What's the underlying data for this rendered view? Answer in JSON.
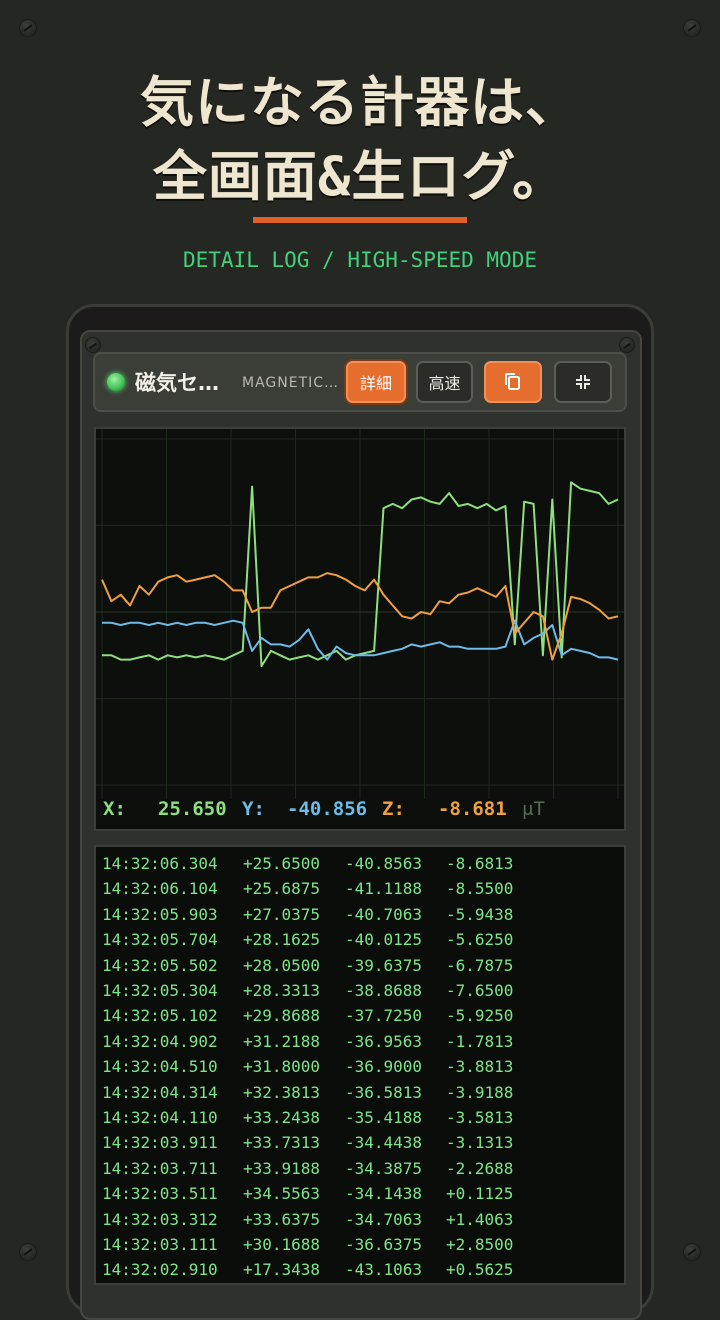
{
  "headline": {
    "line1": "気になる計器は、",
    "line2": "全画面&生ログ。"
  },
  "subtitle": "DETAIL LOG / HIGH-SPEED MODE",
  "sensor": {
    "name": "磁気セ…",
    "name_en": "MAGNETIC…",
    "status": "active"
  },
  "toolbar": {
    "detail_label": "詳細",
    "speed_label": "高速",
    "copy_icon": "copy-icon",
    "collapse_icon": "collapse-icon"
  },
  "colors": {
    "x": "#8ee07e",
    "y": "#6fbbe8",
    "z": "#f0a040",
    "accent": "#e0622a",
    "led": "#4fdc66"
  },
  "readout": {
    "x_label": "X:",
    "x_value": "25.650",
    "y_label": "Y:",
    "y_value": "-40.856",
    "z_label": "Z:",
    "z_value": "-8.681",
    "unit": "μT"
  },
  "chart_data": {
    "type": "line",
    "title": "",
    "xlabel": "",
    "ylabel": "",
    "grid": true,
    "ylim": [
      -80,
      80
    ],
    "series": [
      {
        "values": [
          -20,
          -20,
          -22,
          -22,
          -21,
          -20,
          -22,
          -20,
          -21,
          -20,
          -21,
          -20,
          -21,
          -22,
          -20,
          -18,
          58,
          -25,
          -18,
          -20,
          -22,
          -21,
          -20,
          -22,
          -20,
          -18,
          -22,
          -20,
          -19,
          -18,
          48,
          50,
          48,
          52,
          53,
          51,
          50,
          55,
          49,
          50,
          48,
          50,
          47,
          49,
          -15,
          51,
          50,
          -20,
          52,
          -21,
          60,
          57,
          56,
          55,
          50,
          52
        ]
      },
      {
        "values": [
          -5,
          -5,
          -6,
          -5,
          -5,
          -6,
          -5,
          -6,
          -5,
          -6,
          -5,
          -5,
          -6,
          -5,
          -4,
          -5,
          -18,
          -12,
          -15,
          -15,
          -16,
          -13,
          -8,
          -17,
          -22,
          -16,
          -19,
          -20,
          -20,
          -20,
          -19,
          -18,
          -17,
          -15,
          -16,
          -15,
          -14,
          -16,
          -16,
          -17,
          -17,
          -17,
          -17,
          -16,
          -4,
          -15,
          -12,
          -10,
          -6,
          -20,
          -17,
          -18,
          -19,
          -21,
          -21,
          -22
        ]
      },
      {
        "values": [
          15,
          5,
          8,
          3,
          12,
          8,
          14,
          16,
          17,
          14,
          15,
          16,
          17,
          14,
          10,
          10,
          0,
          2,
          2,
          10,
          12,
          14,
          16,
          16,
          18,
          17,
          15,
          12,
          10,
          15,
          8,
          3,
          -2,
          -3,
          0,
          -1,
          5,
          4,
          8,
          9,
          11,
          9,
          7,
          12,
          -10,
          -5,
          0,
          -2,
          -22,
          -10,
          7,
          6,
          4,
          1,
          -3,
          -2
        ]
      }
    ]
  },
  "log": [
    {
      "time": "14:32:06.304",
      "x": "+25.6500",
      "y": "-40.8563",
      "z": "-8.6813"
    },
    {
      "time": "14:32:06.104",
      "x": "+25.6875",
      "y": "-41.1188",
      "z": "-8.5500"
    },
    {
      "time": "14:32:05.903",
      "x": "+27.0375",
      "y": "-40.7063",
      "z": "-5.9438"
    },
    {
      "time": "14:32:05.704",
      "x": "+28.1625",
      "y": "-40.0125",
      "z": "-5.6250"
    },
    {
      "time": "14:32:05.502",
      "x": "+28.0500",
      "y": "-39.6375",
      "z": "-6.7875"
    },
    {
      "time": "14:32:05.304",
      "x": "+28.3313",
      "y": "-38.8688",
      "z": "-7.6500"
    },
    {
      "time": "14:32:05.102",
      "x": "+29.8688",
      "y": "-37.7250",
      "z": "-5.9250"
    },
    {
      "time": "14:32:04.902",
      "x": "+31.2188",
      "y": "-36.9563",
      "z": "-1.7813"
    },
    {
      "time": "14:32:04.510",
      "x": "+31.8000",
      "y": "-36.9000",
      "z": "-3.8813"
    },
    {
      "time": "14:32:04.314",
      "x": "+32.3813",
      "y": "-36.5813",
      "z": "-3.9188"
    },
    {
      "time": "14:32:04.110",
      "x": "+33.2438",
      "y": "-35.4188",
      "z": "-3.5813"
    },
    {
      "time": "14:32:03.911",
      "x": "+33.7313",
      "y": "-34.4438",
      "z": "-3.1313"
    },
    {
      "time": "14:32:03.711",
      "x": "+33.9188",
      "y": "-34.3875",
      "z": "-2.2688"
    },
    {
      "time": "14:32:03.511",
      "x": "+34.5563",
      "y": "-34.1438",
      "z": "+0.1125"
    },
    {
      "time": "14:32:03.312",
      "x": "+33.6375",
      "y": "-34.7063",
      "z": "+1.4063"
    },
    {
      "time": "14:32:03.111",
      "x": "+30.1688",
      "y": "-36.6375",
      "z": "+2.8500"
    },
    {
      "time": "14:32:02.910",
      "x": "+17.3438",
      "y": "-43.1063",
      "z": "+0.5625"
    }
  ]
}
